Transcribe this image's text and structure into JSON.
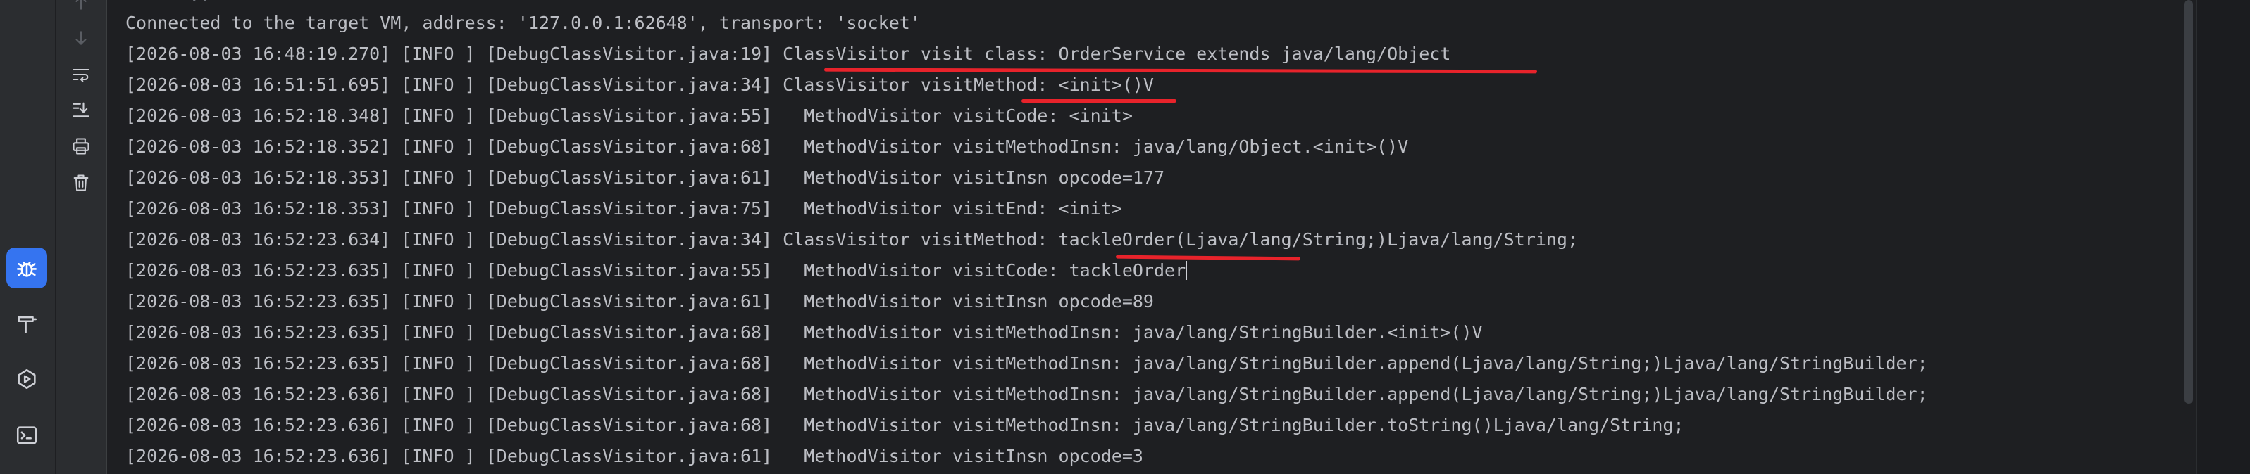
{
  "console": {
    "header": "Connected to the target VM, address: '127.0.0.1:62648', transport: 'socket'",
    "lines": [
      "[2026-08-03 16:48:19.270] [INFO ] [DebugClassVisitor.java:19] ClassVisitor visit class: OrderService extends java/lang/Object",
      "[2026-08-03 16:51:51.695] [INFO ] [DebugClassVisitor.java:34] ClassVisitor visitMethod: <init>()V",
      "[2026-08-03 16:52:18.348] [INFO ] [DebugClassVisitor.java:55]   MethodVisitor visitCode: <init>",
      "[2026-08-03 16:52:18.352] [INFO ] [DebugClassVisitor.java:68]   MethodVisitor visitMethodInsn: java/lang/Object.<init>()V",
      "[2026-08-03 16:52:18.353] [INFO ] [DebugClassVisitor.java:61]   MethodVisitor visitInsn opcode=177",
      "[2026-08-03 16:52:18.353] [INFO ] [DebugClassVisitor.java:75]   MethodVisitor visitEnd: <init>",
      "[2026-08-03 16:52:23.634] [INFO ] [DebugClassVisitor.java:34] ClassVisitor visitMethod: tackleOrder(Ljava/lang/String;)Ljava/lang/String;",
      "[2026-08-03 16:52:23.635] [INFO ] [DebugClassVisitor.java:55]   MethodVisitor visitCode: tackleOrder",
      "[2026-08-03 16:52:23.635] [INFO ] [DebugClassVisitor.java:61]   MethodVisitor visitInsn opcode=89",
      "[2026-08-03 16:52:23.635] [INFO ] [DebugClassVisitor.java:68]   MethodVisitor visitMethodInsn: java/lang/StringBuilder.<init>()V",
      "[2026-08-03 16:52:23.635] [INFO ] [DebugClassVisitor.java:68]   MethodVisitor visitMethodInsn: java/lang/StringBuilder.append(Ljava/lang/String;)Ljava/lang/StringBuilder;",
      "[2026-08-03 16:52:23.636] [INFO ] [DebugClassVisitor.java:68]   MethodVisitor visitMethodInsn: java/lang/StringBuilder.append(Ljava/lang/String;)Ljava/lang/StringBuilder;",
      "[2026-08-03 16:52:23.636] [INFO ] [DebugClassVisitor.java:68]   MethodVisitor visitMethodInsn: java/lang/StringBuilder.toString()Ljava/lang/String;",
      "[2026-08-03 16:52:23.636] [INFO ] [DebugClassVisitor.java:61]   MethodVisitor visitInsn opcode=3"
    ]
  },
  "toolbar": {
    "icons": [
      "arrow-up-icon",
      "arrow-down-icon",
      "soft-wrap-icon",
      "scroll-to-end-icon",
      "print-icon",
      "trash-icon"
    ]
  },
  "sidebar": {
    "icons": [
      "debug-icon",
      "build-icon",
      "services-icon",
      "terminal-icon"
    ],
    "active": "debug-icon"
  },
  "colors": {
    "background": "#1e1f22",
    "text": "#bcbec4",
    "accent": "#3574f0",
    "annotation": "#e8232b"
  }
}
